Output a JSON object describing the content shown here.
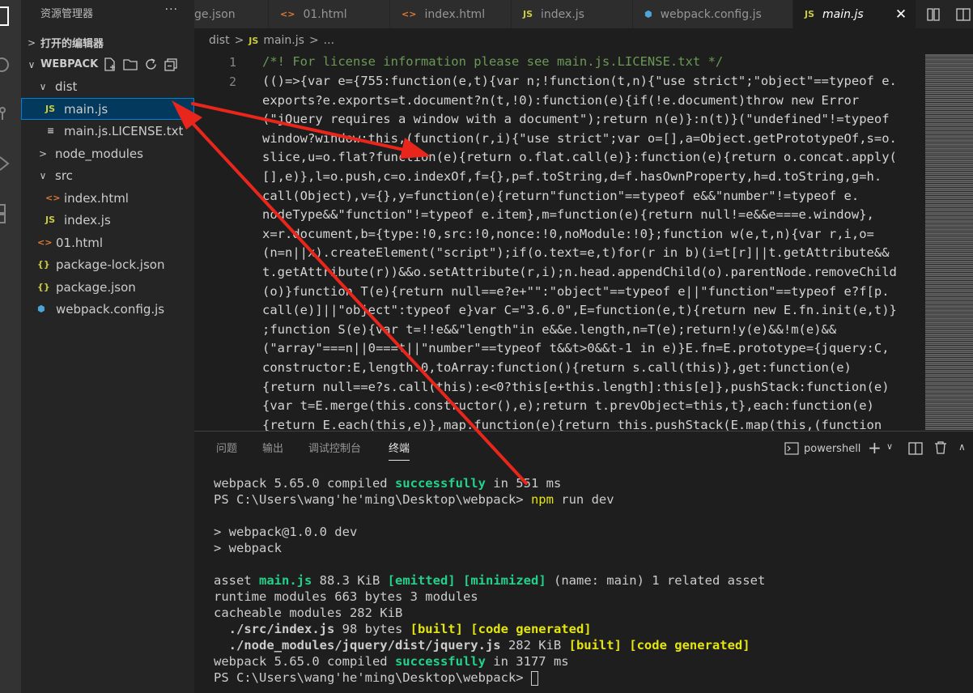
{
  "sidebar": {
    "title": "资源管理器",
    "more": "···",
    "open_editors": "打开的编辑器",
    "workspace": "WEBPACK",
    "tree": [
      {
        "label": "dist",
        "chevron": "∨",
        "icon": ""
      },
      {
        "label": "main.js",
        "chevron": "",
        "icon": "JS"
      },
      {
        "label": "main.js.LICENSE.txt",
        "chevron": "",
        "icon": "≡"
      },
      {
        "label": "node_modules",
        "chevron": ">",
        "icon": ""
      },
      {
        "label": "src",
        "chevron": "∨",
        "icon": ""
      },
      {
        "label": "index.html",
        "chevron": "",
        "icon": "<>"
      },
      {
        "label": "index.js",
        "chevron": "",
        "icon": "JS"
      },
      {
        "label": "01.html",
        "chevron": "",
        "icon": "<>"
      },
      {
        "label": "package-lock.json",
        "chevron": "",
        "icon": "{}"
      },
      {
        "label": "package.json",
        "chevron": "",
        "icon": "{}"
      },
      {
        "label": "webpack.config.js",
        "chevron": "",
        "icon": "⬢"
      }
    ]
  },
  "tabs": [
    {
      "label": "ge.json",
      "icon": ""
    },
    {
      "label": "01.html",
      "icon": "<>"
    },
    {
      "label": "index.html",
      "icon": "<>"
    },
    {
      "label": "index.js",
      "icon": "JS"
    },
    {
      "label": "webpack.config.js",
      "icon": "⬢"
    },
    {
      "label": "main.js",
      "icon": "JS"
    }
  ],
  "tab_close": "✕",
  "breadcrumb": {
    "folder": "dist",
    "icon": "JS",
    "file": "main.js",
    "sep": ">",
    "more": "..."
  },
  "editor": {
    "line_numbers": [
      "1",
      "2"
    ],
    "line1": "/*! For license information please see main.js.LICENSE.txt */",
    "lines": [
      "(()=>{var e={755:function(e,t){var n;!function(t,n){\"use strict\";\"object\"==typeof e.",
      "exports?e.exports=t.document?n(t,!0):function(e){if(!e.document)throw new Error",
      "(\"jQuery requires a window with a document\");return n(e)}:n(t)}(\"undefined\"!=typeof",
      "window?window:this,(function(r,i){\"use strict\";var o=[],a=Object.getPrototypeOf,s=o.",
      "slice,u=o.flat?function(e){return o.flat.call(e)}:function(e){return o.concat.apply(",
      "[],e)},l=o.push,c=o.indexOf,f={},p=f.toString,d=f.hasOwnProperty,h=d.toString,g=h.",
      "call(Object),v={},y=function(e){return\"function\"==typeof e&&\"number\"!=typeof e.",
      "nodeType&&\"function\"!=typeof e.item},m=function(e){return null!=e&&e===e.window},",
      "x=r.document,b={type:!0,src:!0,nonce:!0,noModule:!0};function w(e,t,n){var r,i,o=",
      "(n=n||x).createElement(\"script\");if(o.text=e,t)for(r in b)(i=t[r]||t.getAttribute&&",
      "t.getAttribute(r))&&o.setAttribute(r,i);n.head.appendChild(o).parentNode.removeChild",
      "(o)}function T(e){return null==e?e+\"\":\"object\"==typeof e||\"function\"==typeof e?f[p.",
      "call(e)]||\"object\":typeof e}var C=\"3.6.0\",E=function(e,t){return new E.fn.init(e,t)}",
      ";function S(e){var t=!!e&&\"length\"in e&&e.length,n=T(e);return!y(e)&&!m(e)&&",
      "(\"array\"===n||0===t||\"number\"==typeof t&&t>0&&t-1 in e)}E.fn=E.prototype={jquery:C,",
      "constructor:E,length:0,toArray:function(){return s.call(this)},get:function(e)",
      "{return null==e?s.call(this):e<0?this[e+this.length]:this[e]},pushStack:function(e)",
      "{var t=E.merge(this.constructor(),e);return t.prevObject=this,t},each:function(e)",
      "{return E.each(this,e)},map:function(e){return this.pushStack(E.map(this,(function"
    ]
  },
  "panel": {
    "tabs": [
      "问题",
      "输出",
      "调试控制台",
      "终端"
    ],
    "active_tab": "终端",
    "shell": "powershell",
    "terminal": {
      "l1a": "webpack 5.65.0 compiled ",
      "l1b": "successfully",
      "l1c": " in 551 ms",
      "l2a": "PS C:\\Users\\wang'he'ming\\Desktop\\webpack> ",
      "l2b": "npm",
      "l2c": " run dev",
      "l3": "> webpack@1.0.0 dev",
      "l4": "> webpack",
      "l5a": "asset ",
      "l5b": "main.js",
      "l5c": " 88.3 KiB ",
      "l5d": "[emitted]",
      "l5e": " ",
      "l5f": "[minimized]",
      "l5g": " (name: main) 1 related asset",
      "l6": "runtime modules 663 bytes 3 modules",
      "l7": "cacheable modules 282 KiB",
      "l8a": "  ./src/index.js",
      "l8b": " 98 bytes ",
      "l8c": "[built] [code generated]",
      "l9a": "  ./node_modules/jquery/dist/jquery.js",
      "l9b": " 282 KiB ",
      "l9c": "[built] [code generated]",
      "l10a": "webpack 5.65.0 compiled ",
      "l10b": "successfully",
      "l10c": " in 3177 ms",
      "l11": "PS C:\\Users\\wang'he'ming\\Desktop\\webpack> "
    }
  },
  "colors": {
    "accent": "#007fd4",
    "success": "#23d18b",
    "warning": "#e5e510",
    "annotation": "#e8261c"
  }
}
